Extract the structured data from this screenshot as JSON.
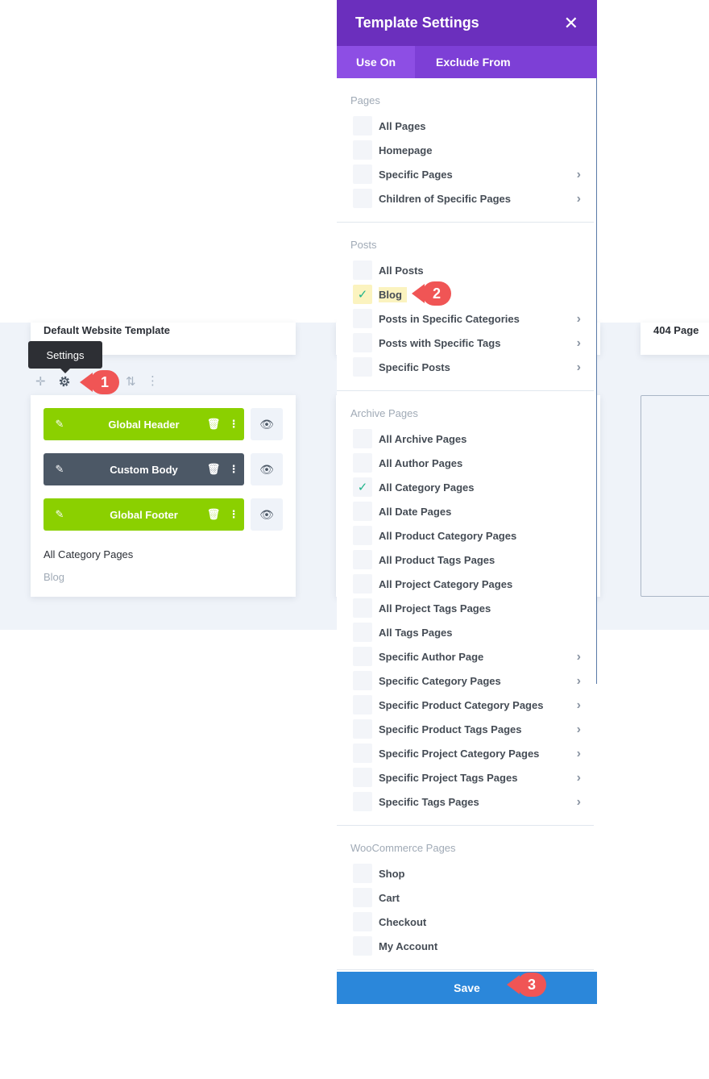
{
  "background_cards": {
    "left": {
      "title": "Default Website Template"
    },
    "right": {
      "title": "404 Page"
    }
  },
  "tooltip": {
    "label": "Settings"
  },
  "template_card": {
    "rows": [
      {
        "label": "Global Header",
        "color": "#8bd000"
      },
      {
        "label": "Custom Body",
        "color": "#4c5866"
      },
      {
        "label": "Global Footer",
        "color": "#8bd000"
      }
    ],
    "use_on": "All Category Pages",
    "exclude": "Blog"
  },
  "markers": [
    "1",
    "2",
    "3"
  ],
  "modal": {
    "title": "Template Settings",
    "close_symbol": "✕",
    "tabs": {
      "active": "Use On",
      "inactive": "Exclude From"
    },
    "sections": [
      {
        "label": "Pages",
        "options": [
          {
            "label": "All Pages",
            "checked": false,
            "chevron": false
          },
          {
            "label": "Homepage",
            "checked": false,
            "chevron": false
          },
          {
            "label": "Specific Pages",
            "checked": false,
            "chevron": true
          },
          {
            "label": "Children of Specific Pages",
            "checked": false,
            "chevron": true
          }
        ]
      },
      {
        "label": "Posts",
        "options": [
          {
            "label": "All Posts",
            "checked": false,
            "chevron": false
          },
          {
            "label": "Blog",
            "checked": true,
            "chevron": false,
            "highlight": true
          },
          {
            "label": "Posts in Specific Categories",
            "checked": false,
            "chevron": true
          },
          {
            "label": "Posts with Specific Tags",
            "checked": false,
            "chevron": true
          },
          {
            "label": "Specific Posts",
            "checked": false,
            "chevron": true
          }
        ]
      },
      {
        "label": "Archive Pages",
        "options": [
          {
            "label": "All Archive Pages",
            "checked": false,
            "chevron": false
          },
          {
            "label": "All Author Pages",
            "checked": false,
            "chevron": false
          },
          {
            "label": "All Category Pages",
            "checked": true,
            "chevron": false
          },
          {
            "label": "All Date Pages",
            "checked": false,
            "chevron": false
          },
          {
            "label": "All Product Category Pages",
            "checked": false,
            "chevron": false
          },
          {
            "label": "All Product Tags Pages",
            "checked": false,
            "chevron": false
          },
          {
            "label": "All Project Category Pages",
            "checked": false,
            "chevron": false
          },
          {
            "label": "All Project Tags Pages",
            "checked": false,
            "chevron": false
          },
          {
            "label": "All Tags Pages",
            "checked": false,
            "chevron": false
          },
          {
            "label": "Specific Author Page",
            "checked": false,
            "chevron": true
          },
          {
            "label": "Specific Category Pages",
            "checked": false,
            "chevron": true
          },
          {
            "label": "Specific Product Category Pages",
            "checked": false,
            "chevron": true
          },
          {
            "label": "Specific Product Tags Pages",
            "checked": false,
            "chevron": true
          },
          {
            "label": "Specific Project Category Pages",
            "checked": false,
            "chevron": true
          },
          {
            "label": "Specific Project Tags Pages",
            "checked": false,
            "chevron": true
          },
          {
            "label": "Specific Tags Pages",
            "checked": false,
            "chevron": true
          }
        ]
      },
      {
        "label": "WooCommerce Pages",
        "options": [
          {
            "label": "Shop",
            "checked": false,
            "chevron": false
          },
          {
            "label": "Cart",
            "checked": false,
            "chevron": false
          },
          {
            "label": "Checkout",
            "checked": false,
            "chevron": false
          },
          {
            "label": "My Account",
            "checked": false,
            "chevron": false
          }
        ]
      }
    ],
    "save_label": "Save"
  },
  "colors": {
    "purple_header": "#6b2fbd",
    "purple_tabs": "#7d3fd6",
    "save_blue": "#2b87da",
    "marker_red": "#f05555",
    "check_green": "#1fb38a"
  }
}
